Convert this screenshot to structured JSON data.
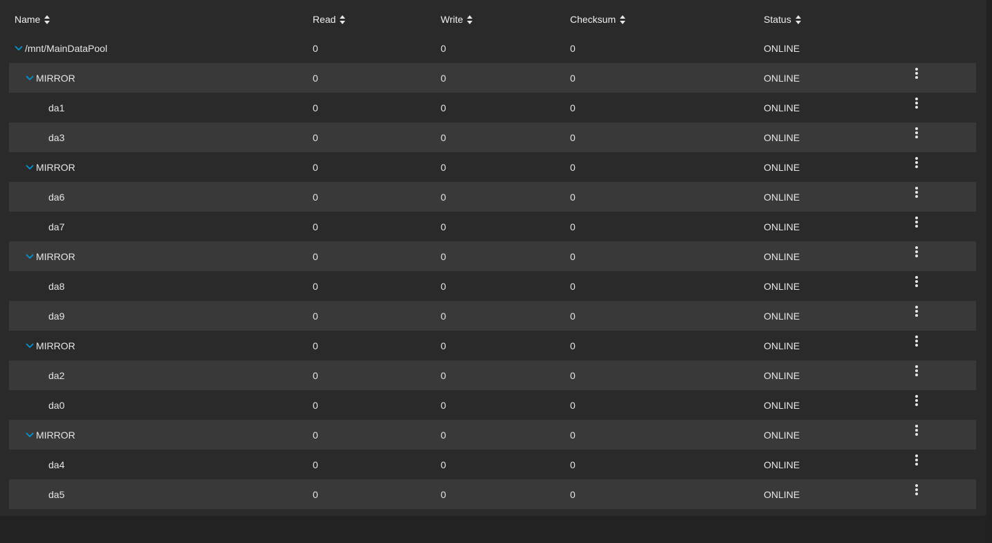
{
  "colors": {
    "background": "#2a2a2a",
    "stripe": "#393939",
    "accent": "#0095d5",
    "text": "#e6e6e6"
  },
  "columns": {
    "name": "Name",
    "read": "Read",
    "write": "Write",
    "checksum": "Checksum",
    "status": "Status"
  },
  "rows": [
    {
      "name": "/mnt/MainDataPool",
      "read": "0",
      "write": "0",
      "checksum": "0",
      "status": "ONLINE"
    },
    {
      "name": "MIRROR",
      "read": "0",
      "write": "0",
      "checksum": "0",
      "status": "ONLINE"
    },
    {
      "name": "da1",
      "read": "0",
      "write": "0",
      "checksum": "0",
      "status": "ONLINE"
    },
    {
      "name": "da3",
      "read": "0",
      "write": "0",
      "checksum": "0",
      "status": "ONLINE"
    },
    {
      "name": "MIRROR",
      "read": "0",
      "write": "0",
      "checksum": "0",
      "status": "ONLINE"
    },
    {
      "name": "da6",
      "read": "0",
      "write": "0",
      "checksum": "0",
      "status": "ONLINE"
    },
    {
      "name": "da7",
      "read": "0",
      "write": "0",
      "checksum": "0",
      "status": "ONLINE"
    },
    {
      "name": "MIRROR",
      "read": "0",
      "write": "0",
      "checksum": "0",
      "status": "ONLINE"
    },
    {
      "name": "da8",
      "read": "0",
      "write": "0",
      "checksum": "0",
      "status": "ONLINE"
    },
    {
      "name": "da9",
      "read": "0",
      "write": "0",
      "checksum": "0",
      "status": "ONLINE"
    },
    {
      "name": "MIRROR",
      "read": "0",
      "write": "0",
      "checksum": "0",
      "status": "ONLINE"
    },
    {
      "name": "da2",
      "read": "0",
      "write": "0",
      "checksum": "0",
      "status": "ONLINE"
    },
    {
      "name": "da0",
      "read": "0",
      "write": "0",
      "checksum": "0",
      "status": "ONLINE"
    },
    {
      "name": "MIRROR",
      "read": "0",
      "write": "0",
      "checksum": "0",
      "status": "ONLINE"
    },
    {
      "name": "da4",
      "read": "0",
      "write": "0",
      "checksum": "0",
      "status": "ONLINE"
    },
    {
      "name": "da5",
      "read": "0",
      "write": "0",
      "checksum": "0",
      "status": "ONLINE"
    }
  ]
}
